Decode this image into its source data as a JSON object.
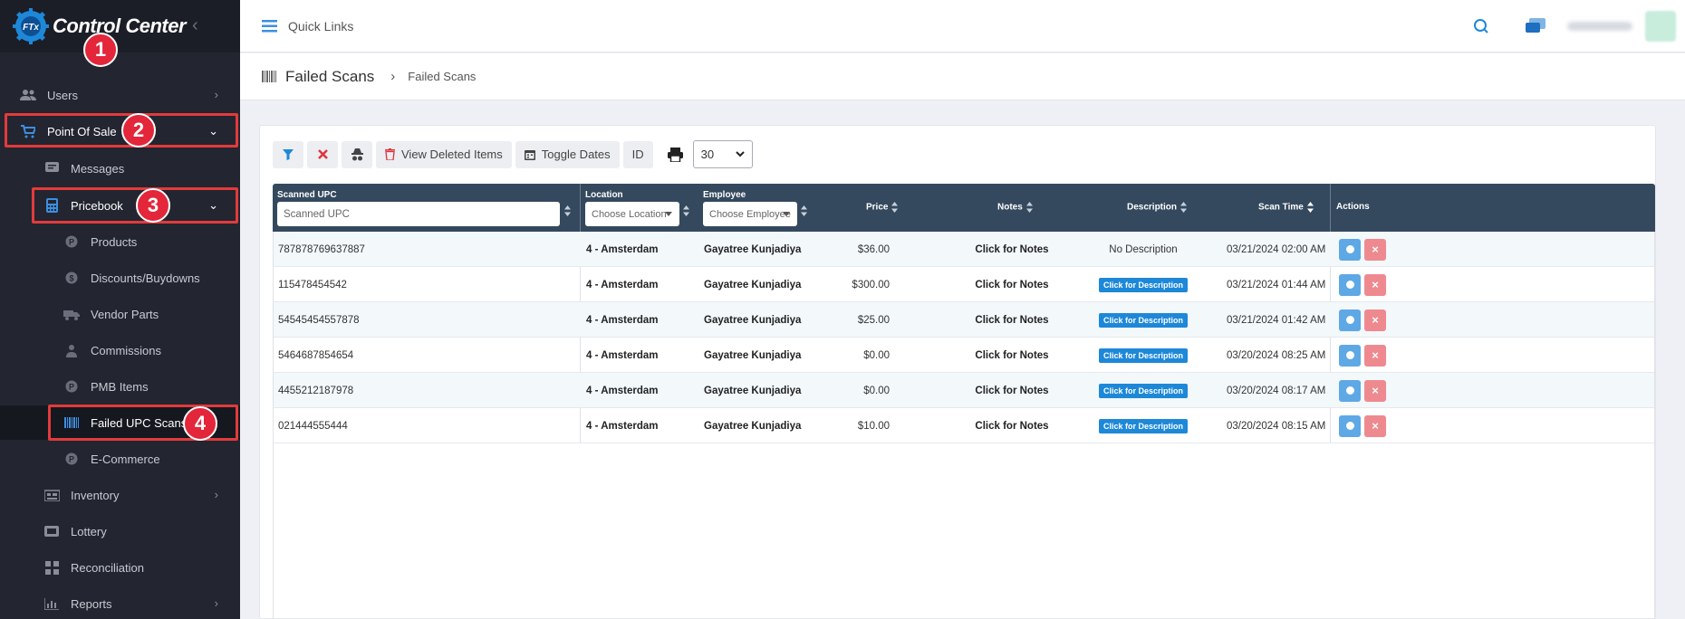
{
  "app": {
    "title": "Control Center",
    "logo_text": "FTx"
  },
  "colors": {
    "sidebar": "#232530",
    "header": "#34495e",
    "accent": "#1e88d8",
    "annotation": "#e3263a"
  },
  "sidebar": {
    "items": [
      {
        "label": "Users",
        "icon": "users-icon"
      },
      {
        "label": "Point Of Sale",
        "icon": "cart-icon"
      },
      {
        "label": "Messages",
        "icon": "message-icon"
      },
      {
        "label": "Pricebook",
        "icon": "calculator-icon"
      },
      {
        "label": "Products",
        "icon": "tag-icon"
      },
      {
        "label": "Discounts/Buydowns",
        "icon": "discount-icon"
      },
      {
        "label": "Vendor Parts",
        "icon": "truck-icon"
      },
      {
        "label": "Commissions",
        "icon": "commission-icon"
      },
      {
        "label": "PMB Items",
        "icon": "box-icon"
      },
      {
        "label": "Failed UPC Scans",
        "icon": "barcode-icon"
      },
      {
        "label": "E-Commerce",
        "icon": "ecommerce-icon"
      },
      {
        "label": "Inventory",
        "icon": "inventory-icon"
      },
      {
        "label": "Lottery",
        "icon": "ticket-icon"
      },
      {
        "label": "Reconciliation",
        "icon": "grid-icon"
      },
      {
        "label": "Reports",
        "icon": "chart-icon"
      }
    ]
  },
  "annotations": [
    "1",
    "2",
    "3",
    "4"
  ],
  "topbar": {
    "quick_links": "Quick Links"
  },
  "breadcrumb": {
    "title": "Failed Scans",
    "current": "Failed Scans"
  },
  "toolbar": {
    "view_deleted": "View Deleted Items",
    "toggle_dates": "Toggle Dates",
    "id": "ID",
    "page_size": "30"
  },
  "table": {
    "headers": {
      "upc": "Scanned UPC",
      "upc_placeholder": "Scanned UPC",
      "location": "Location",
      "location_placeholder": "Choose Location",
      "employee": "Employee",
      "employee_placeholder": "Choose Employee",
      "price": "Price",
      "notes": "Notes",
      "description": "Description",
      "scan_time": "Scan Time",
      "actions": "Actions"
    },
    "rows": [
      {
        "upc": "787878769637887",
        "location": "4 - Amsterdam",
        "employee": "Gayatree Kunjadiya",
        "price": "$36.00",
        "notes": "Click for Notes",
        "description": "No Description",
        "desc_badge": false,
        "scan_time": "03/21/2024 02:00 AM"
      },
      {
        "upc": "115478454542",
        "location": "4 - Amsterdam",
        "employee": "Gayatree Kunjadiya",
        "price": "$300.00",
        "notes": "Click for Notes",
        "description": "Click for Description",
        "desc_badge": true,
        "scan_time": "03/21/2024 01:44 AM"
      },
      {
        "upc": "54545454557878",
        "location": "4 - Amsterdam",
        "employee": "Gayatree Kunjadiya",
        "price": "$25.00",
        "notes": "Click for Notes",
        "description": "Click for Description",
        "desc_badge": true,
        "scan_time": "03/21/2024 01:42 AM"
      },
      {
        "upc": "5464687854654",
        "location": "4 - Amsterdam",
        "employee": "Gayatree Kunjadiya",
        "price": "$0.00",
        "notes": "Click for Notes",
        "description": "Click for Description",
        "desc_badge": true,
        "scan_time": "03/20/2024 08:25 AM"
      },
      {
        "upc": "4455212187978",
        "location": "4 - Amsterdam",
        "employee": "Gayatree Kunjadiya",
        "price": "$0.00",
        "notes": "Click for Notes",
        "description": "Click for Description",
        "desc_badge": true,
        "scan_time": "03/20/2024 08:17 AM"
      },
      {
        "upc": "021444555444",
        "location": "4 - Amsterdam",
        "employee": "Gayatree Kunjadiya",
        "price": "$10.00",
        "notes": "Click for Notes",
        "description": "Click for Description",
        "desc_badge": true,
        "scan_time": "03/20/2024 08:15 AM"
      }
    ]
  }
}
